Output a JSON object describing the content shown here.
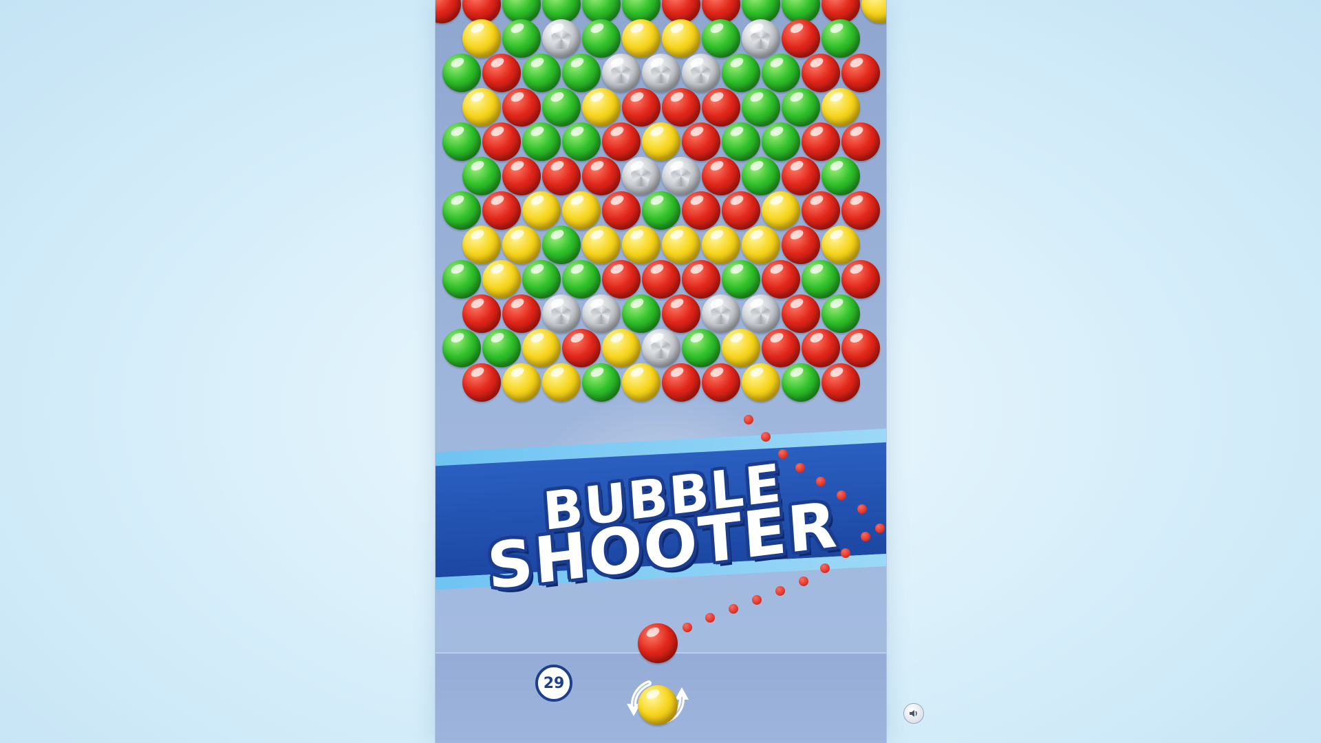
{
  "title": {
    "line1": "BUBBLE",
    "line2": "SHOOTER"
  },
  "hud": {
    "moves_left": "29"
  },
  "colors": {
    "red": "#e0261a",
    "green": "#2fbf2a",
    "yellow": "#f7d51d",
    "stone": "#c9cdd2",
    "banner": "#1c47a3",
    "board": "#9fb6dc"
  },
  "bubble_grid": {
    "rows": [
      "RRGGGGRRGGRY",
      "YGSGYYGSRG",
      "GRGGSSSGGRR",
      "YRGYRRRGGY",
      "GRGGRYRGGRR",
      "GRRRSSRGRG",
      "GRYYRGRRYRR",
      "YYGYYYYYRY",
      "GYGGRRRGRGR",
      "RRSSGRSSRG",
      "GGYRYSGYRRR",
      "RYYGYRRYGR"
    ],
    "legend": {
      "R": "red",
      "G": "green",
      "Y": "yellow",
      "S": "stone"
    }
  },
  "shooter": {
    "loaded_color": "red",
    "next_color": "yellow"
  },
  "icons": {
    "swap": "swap-arrows-icon",
    "sound": "sound-icon"
  }
}
